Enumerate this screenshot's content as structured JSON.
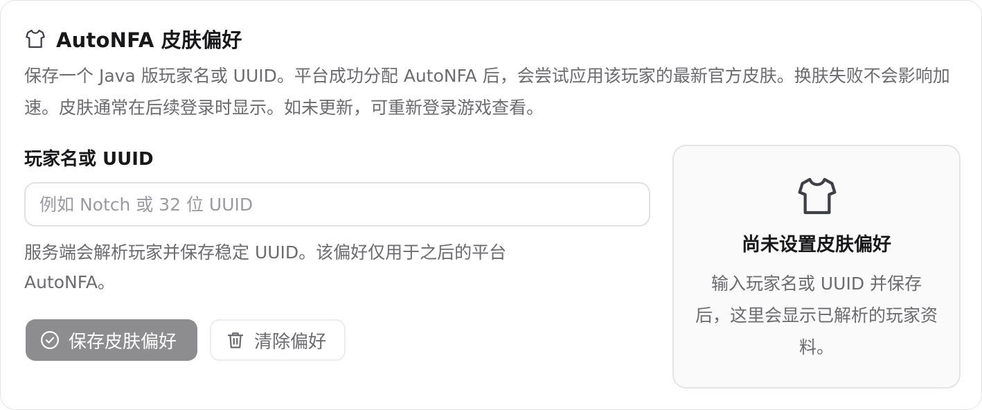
{
  "header": {
    "icon": "shirt-icon",
    "title": "AutoNFA 皮肤偏好"
  },
  "description": "保存一个 Java 版玩家名或 UUID。平台成功分配 AutoNFA 后，会尝试应用该玩家的最新官方皮肤。换肤失败不会影响加速。皮肤通常在后续登录时显示。如未更新，可重新登录游戏查看。",
  "form": {
    "label": "玩家名或 UUID",
    "value": "",
    "placeholder": "例如 Notch 或 32 位 UUID",
    "hint": "服务端会解析玩家并保存稳定 UUID。该偏好仅用于之后的平台 AutoNFA。"
  },
  "actions": {
    "save_label": "保存皮肤偏好",
    "save_icon": "check-circle-icon",
    "clear_label": "清除偏好",
    "clear_icon": "trash-icon"
  },
  "preview": {
    "icon": "shirt-icon",
    "title": "尚未设置皮肤偏好",
    "description": "输入玩家名或 UUID 并保存后，这里会显示已解析的玩家资料。"
  },
  "colors": {
    "primary_button": "#8d8d8f",
    "text_muted": "#6b6b70",
    "border": "#e4e4e7"
  }
}
